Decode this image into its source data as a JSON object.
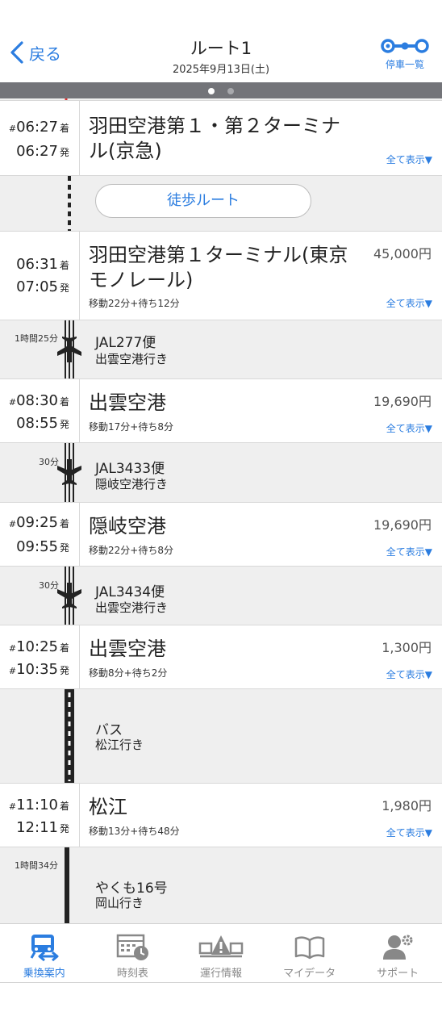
{
  "header": {
    "back_label": "戻る",
    "title": "ルート1",
    "date": "2025年9月13日(土)",
    "stops_label": "停車一覧"
  },
  "colors": {
    "accent": "#2b7de0",
    "pager": "#737479",
    "rail": "#222222",
    "background": "#efefef"
  },
  "stations": [
    {
      "arr_hash": true,
      "arr": "06:27",
      "arr_suffix": "着",
      "dep_hash": false,
      "dep": "06:27",
      "dep_suffix": "発",
      "name": "羽田空港第１・第２ターミナル(京急)",
      "fare": "",
      "move": "",
      "show_all": "全て表示▼"
    },
    {
      "arr_hash": false,
      "arr": "06:31",
      "arr_suffix": "着",
      "dep_hash": false,
      "dep": "07:05",
      "dep_suffix": "発",
      "name": "羽田空港第１ターミナル(東京モノレール)",
      "fare": "45,000円",
      "move": "移動22分+待ち12分",
      "show_all": "全て表示▼"
    },
    {
      "arr_hash": true,
      "arr": "08:30",
      "arr_suffix": "着",
      "dep_hash": false,
      "dep": "08:55",
      "dep_suffix": "発",
      "name": "出雲空港",
      "fare": "19,690円",
      "move": "移動17分+待ち8分",
      "show_all": "全て表示▼"
    },
    {
      "arr_hash": true,
      "arr": "09:25",
      "arr_suffix": "着",
      "dep_hash": false,
      "dep": "09:55",
      "dep_suffix": "発",
      "name": "隠岐空港",
      "fare": "19,690円",
      "move": "移動22分+待ち8分",
      "show_all": "全て表示▼"
    },
    {
      "arr_hash": true,
      "arr": "10:25",
      "arr_suffix": "着",
      "dep_hash": true,
      "dep": "10:35",
      "dep_suffix": "発",
      "name": "出雲空港",
      "fare": "1,300円",
      "move": "移動8分+待ち2分",
      "show_all": "全て表示▼"
    },
    {
      "arr_hash": true,
      "arr": "11:10",
      "arr_suffix": "着",
      "dep_hash": false,
      "dep": "12:11",
      "dep_suffix": "発",
      "name": "松江",
      "fare": "1,980円",
      "move": "移動13分+待ち48分",
      "show_all": "全て表示▼"
    }
  ],
  "segments": [
    {
      "mode": "walk",
      "label": "徒歩ルート"
    },
    {
      "mode": "flight",
      "duration": "1時間25分",
      "line": "JAL277便",
      "dest": "出雲空港行き"
    },
    {
      "mode": "flight",
      "duration": "30分",
      "line": "JAL3433便",
      "dest": "隠岐空港行き"
    },
    {
      "mode": "flight",
      "duration": "30分",
      "line": "JAL3434便",
      "dest": "出雲空港行き"
    },
    {
      "mode": "bus",
      "duration": "",
      "line": "バス",
      "dest": "松江行き"
    },
    {
      "mode": "train",
      "duration": "1時間34分",
      "line": "やくも16号",
      "dest": "岡山行き"
    }
  ],
  "nav": [
    {
      "label": "乗換案内",
      "icon": "transfer-icon",
      "active": true
    },
    {
      "label": "時刻表",
      "icon": "timetable-icon",
      "active": false
    },
    {
      "label": "運行情報",
      "icon": "alert-train-icon",
      "active": false
    },
    {
      "label": "マイデータ",
      "icon": "book-icon",
      "active": false
    },
    {
      "label": "サポート",
      "icon": "support-user-icon",
      "active": false
    }
  ]
}
